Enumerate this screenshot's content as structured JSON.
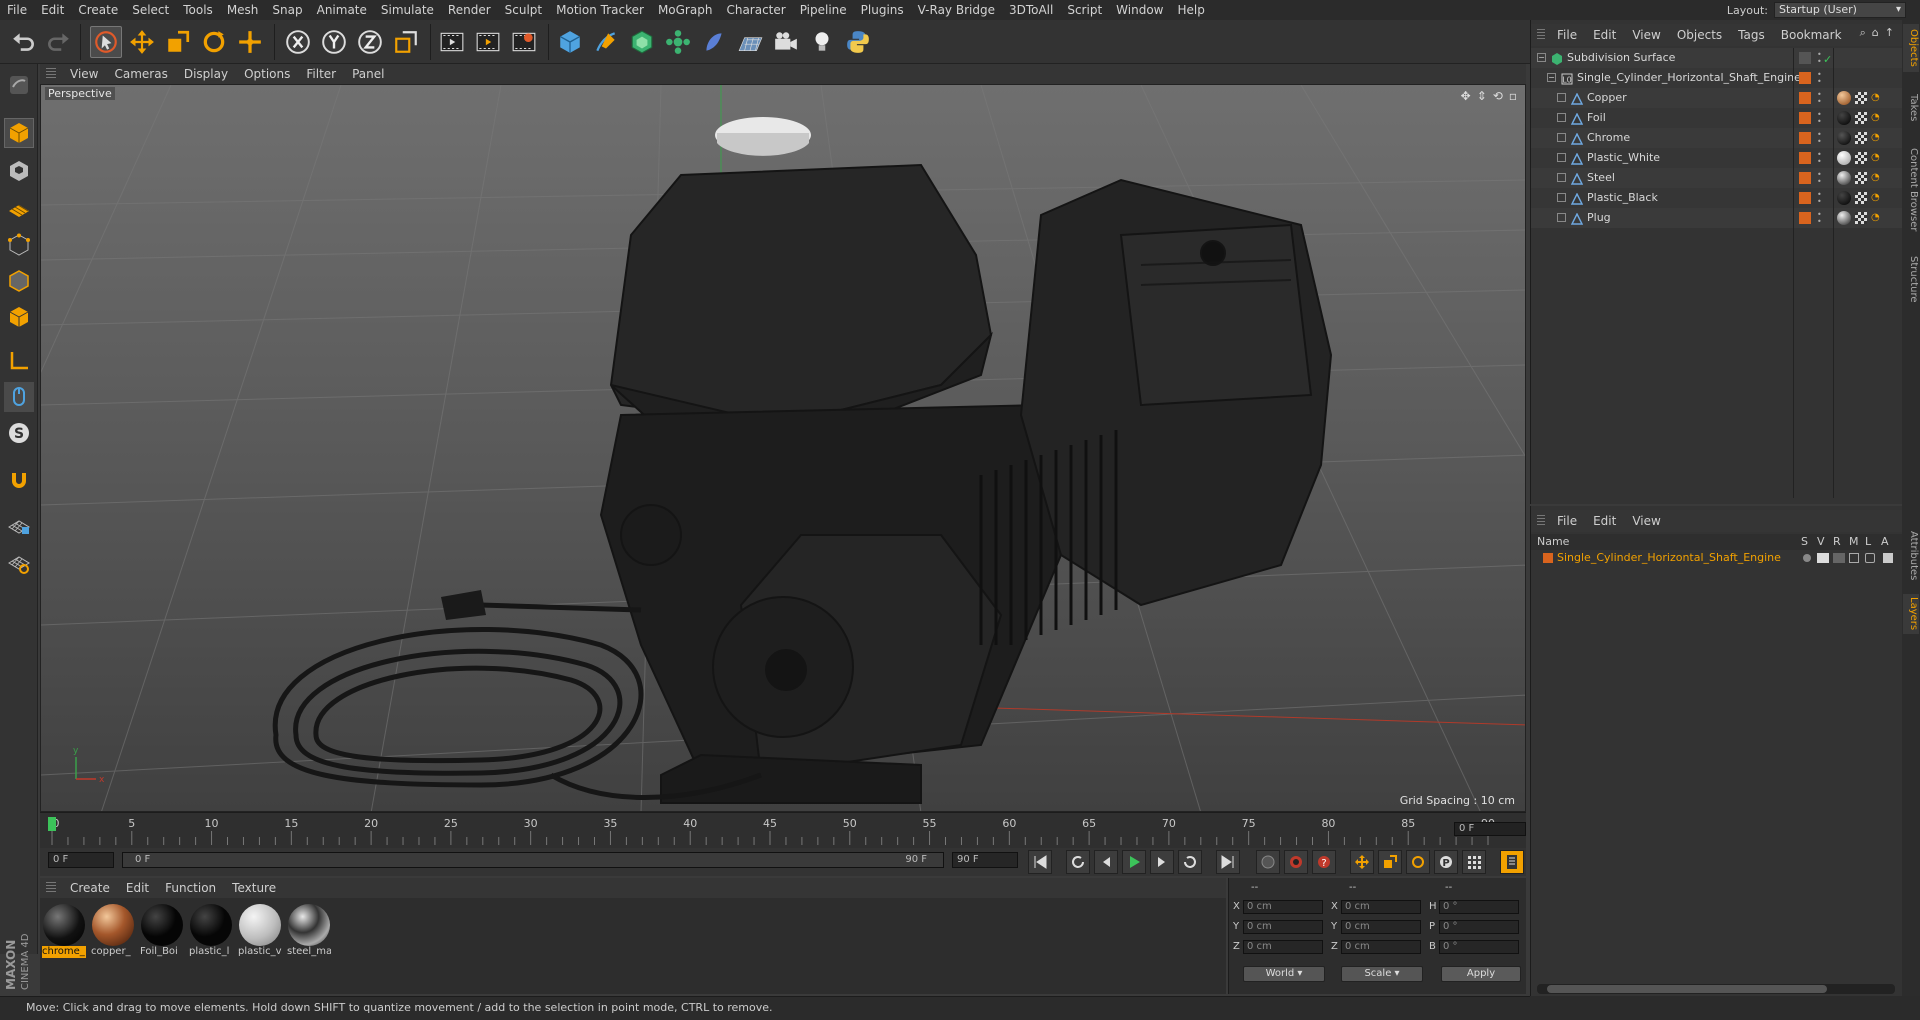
{
  "menu": [
    "File",
    "Edit",
    "Create",
    "Select",
    "Tools",
    "Mesh",
    "Snap",
    "Animate",
    "Simulate",
    "Render",
    "Sculpt",
    "Motion Tracker",
    "MoGraph",
    "Character",
    "Pipeline",
    "Plugins",
    "V-Ray Bridge",
    "3DToAll",
    "Script",
    "Window",
    "Help"
  ],
  "layout": {
    "label": "Layout:",
    "value": "Startup (User)"
  },
  "viewport": {
    "menu": [
      "View",
      "Cameras",
      "Display",
      "Options",
      "Filter",
      "Panel"
    ],
    "label": "Perspective",
    "grid_spacing": "Grid Spacing : 10 cm"
  },
  "timeline": {
    "ticks": [
      "0",
      "5",
      "10",
      "15",
      "20",
      "25",
      "30",
      "35",
      "40",
      "45",
      "50",
      "55",
      "60",
      "65",
      "70",
      "75",
      "80",
      "85",
      "90"
    ],
    "current_frame": "0 F",
    "start_field": "0 F",
    "range_left": "0 F",
    "range_right": "90 F",
    "end_field": "90 F"
  },
  "materials": {
    "menu": [
      "Create",
      "Edit",
      "Function",
      "Texture"
    ],
    "items": [
      {
        "label": "chrome_",
        "selected": true
      },
      {
        "label": "copper_",
        "selected": false
      },
      {
        "label": "Foil_Boi",
        "selected": false
      },
      {
        "label": "plastic_l",
        "selected": false
      },
      {
        "label": "plastic_v",
        "selected": false
      },
      {
        "label": "steel_ma",
        "selected": false
      }
    ]
  },
  "coords": {
    "headers": [
      "--",
      "--",
      "--"
    ],
    "rows": [
      {
        "a": "X",
        "av": "0 cm",
        "b": "X",
        "bv": "0 cm",
        "c": "H",
        "cv": "0 °"
      },
      {
        "a": "Y",
        "av": "0 cm",
        "b": "Y",
        "bv": "0 cm",
        "c": "P",
        "cv": "0 °"
      },
      {
        "a": "Z",
        "av": "0 cm",
        "b": "Z",
        "bv": "0 cm",
        "c": "B",
        "cv": "0 °"
      }
    ],
    "world": "World",
    "scale": "Scale",
    "apply": "Apply"
  },
  "status": "Move: Click and drag to move elements. Hold down SHIFT to quantize movement / add to the selection in point mode, CTRL to remove.",
  "objects": {
    "menu": [
      "File",
      "Edit",
      "View",
      "Objects",
      "Tags",
      "Bookmark"
    ],
    "items": [
      {
        "name": "Subdivision Surface",
        "level": 0
      },
      {
        "name": "Single_Cylinder_Horizontal_Shaft_Engine",
        "level": 1
      },
      {
        "name": "Copper",
        "level": 2
      },
      {
        "name": "Foil",
        "level": 2
      },
      {
        "name": "Chrome",
        "level": 2
      },
      {
        "name": "Plastic_White",
        "level": 2
      },
      {
        "name": "Steel",
        "level": 2
      },
      {
        "name": "Plastic_Black",
        "level": 2
      },
      {
        "name": "Plug",
        "level": 2
      }
    ]
  },
  "layers": {
    "menu": [
      "File",
      "Edit",
      "View"
    ],
    "header": {
      "name": "Name",
      "cols": [
        "S",
        "V",
        "R",
        "M",
        "L",
        "A"
      ]
    },
    "items": [
      {
        "name": "Single_Cylinder_Horizontal_Shaft_Engine"
      }
    ]
  },
  "side_tabs": [
    "Objects",
    "Takes",
    "Content Browser",
    "Structure",
    "Attributes",
    "Layers"
  ],
  "brand": "MAXON CINEMA 4D",
  "colors": {
    "accent": "#f2a100",
    "layer_text": "#f2a100",
    "tag_orange": "#d9641e"
  }
}
